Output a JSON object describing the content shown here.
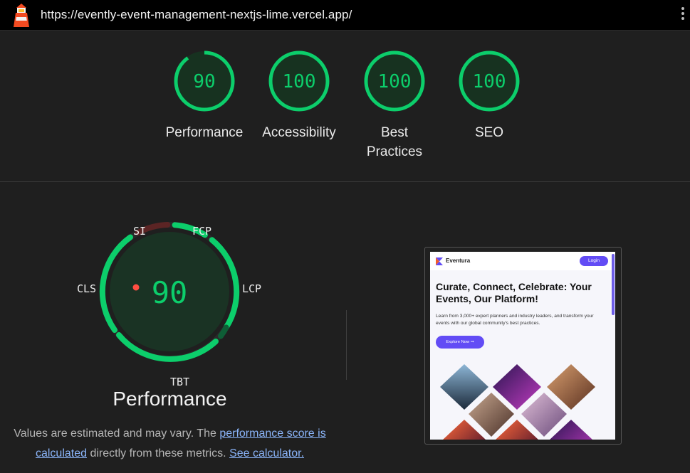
{
  "browser": {
    "url": "https://evently-event-management-nextjs-lime.vercel.app/",
    "logo_icon": "lighthouse-icon",
    "menu_icon": "kebab-menu-icon"
  },
  "summary": {
    "gauges": [
      {
        "score": "90",
        "label": "Performance",
        "value": 0.9,
        "color": "#0cce6b"
      },
      {
        "score": "100",
        "label": "Accessibility",
        "value": 1.0,
        "color": "#0cce6b"
      },
      {
        "score": "100",
        "label": "Best Practices",
        "value": 1.0,
        "color": "#0cce6b"
      },
      {
        "score": "100",
        "label": "SEO",
        "value": 1.0,
        "color": "#0cce6b"
      }
    ]
  },
  "performance": {
    "score": "90",
    "title": "Performance",
    "metrics": {
      "si": "SI",
      "fcp": "FCP",
      "lcp": "LCP",
      "tbt": "TBT",
      "cls": "CLS"
    },
    "colors": {
      "pass": "#0cce6b",
      "fail": "#ff4e42",
      "fail_dim": "#5b2424"
    },
    "disclaimer": {
      "prefix": "Values are estimated and may vary. The ",
      "link1": "performance score is calculated",
      "middle": " directly from these metrics. ",
      "link2": "See calculator."
    }
  },
  "screenshot": {
    "brand": "Eventura",
    "login_label": "Login",
    "headline": "Curate, Connect, Celebrate: Your Events, Our Platform!",
    "paragraph": "Learn from 3,000+ expert planners and industry leaders, and transform your events with our global community's best practices.",
    "cta_label": "Explore Now ➞",
    "accent": "#624cf5"
  }
}
